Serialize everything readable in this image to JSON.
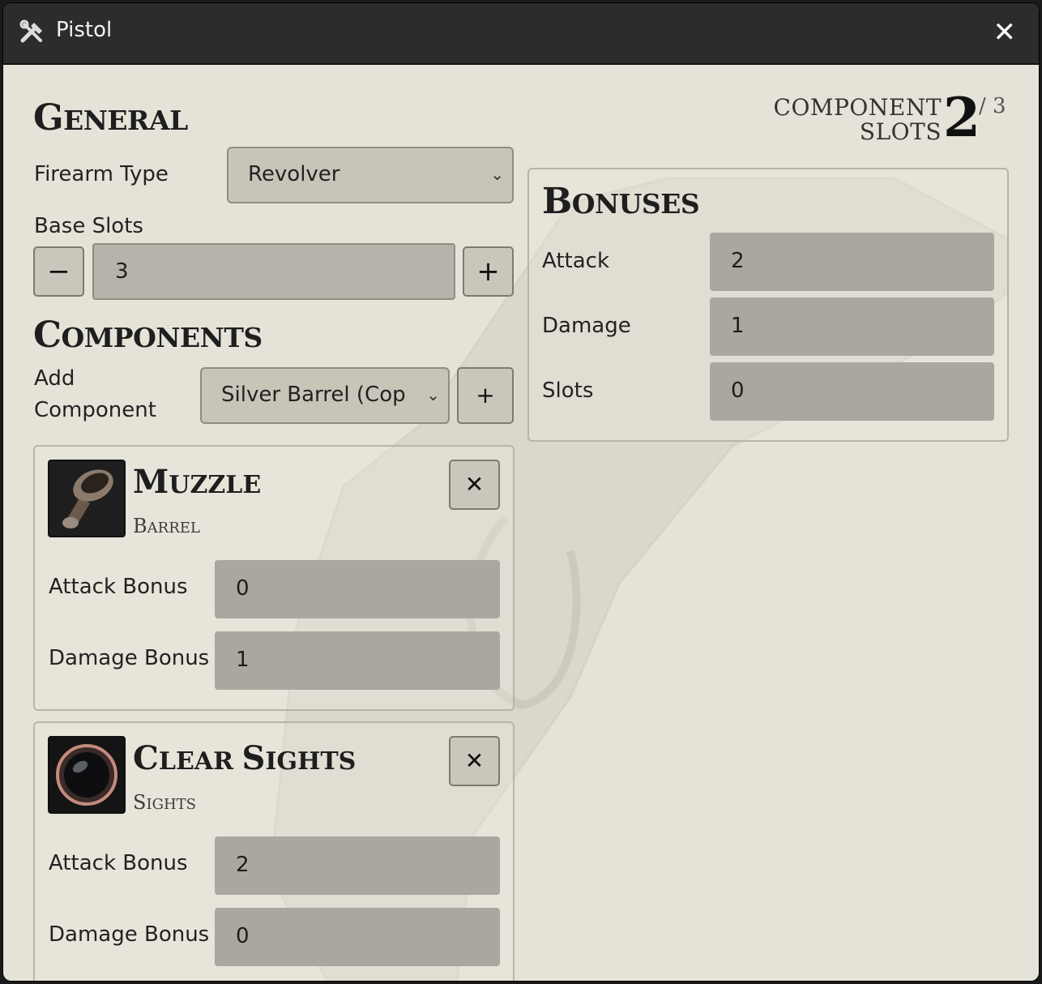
{
  "window": {
    "title": "Pistol",
    "close_glyph": "✕",
    "title_icon": "crossed-tools-icon"
  },
  "general": {
    "heading_first": "G",
    "heading_rest": "eneral",
    "firearm_type_label": "Firearm Type",
    "firearm_type_value": "Revolver",
    "base_slots_label": "Base Slots",
    "base_slots_value": "3",
    "minus_glyph": "−",
    "plus_glyph": "+"
  },
  "components": {
    "heading_first": "C",
    "heading_rest": "omponents",
    "add_label_line1": "Add",
    "add_label_line2": "Component",
    "add_select_value": "Silver Barrel (Cop",
    "add_button_glyph": "+",
    "items": [
      {
        "name_first": "M",
        "name_rest": "uzzle",
        "type_first": "B",
        "type_rest": "arrel",
        "icon": "muzzle-icon",
        "attack_label": "Attack Bonus",
        "attack_value": "0",
        "damage_label": "Damage Bonus",
        "damage_value": "1",
        "remove_glyph": "✕"
      },
      {
        "name_first": "C",
        "name_mid": "lear ",
        "name_second": "S",
        "name_rest": "ights",
        "type_first": "S",
        "type_rest": "ights",
        "icon": "sights-lens-icon",
        "attack_label": "Attack Bonus",
        "attack_value": "2",
        "damage_label": "Damage Bonus",
        "damage_value": "0",
        "remove_glyph": "✕"
      }
    ]
  },
  "component_slots": {
    "label_line1": "COMPONENT",
    "label_line2": "SLOTS",
    "used": "2",
    "max": "/ 3"
  },
  "bonuses": {
    "heading_first": "B",
    "heading_rest": "onuses",
    "attack_label": "Attack",
    "attack_value": "2",
    "damage_label": "Damage",
    "damage_value": "1",
    "slots_label": "Slots",
    "slots_value": "0"
  },
  "colors": {
    "titlebar": "#2c2c2c",
    "parchment": "#e5e2d8",
    "input_fill": "#a9a79f"
  }
}
